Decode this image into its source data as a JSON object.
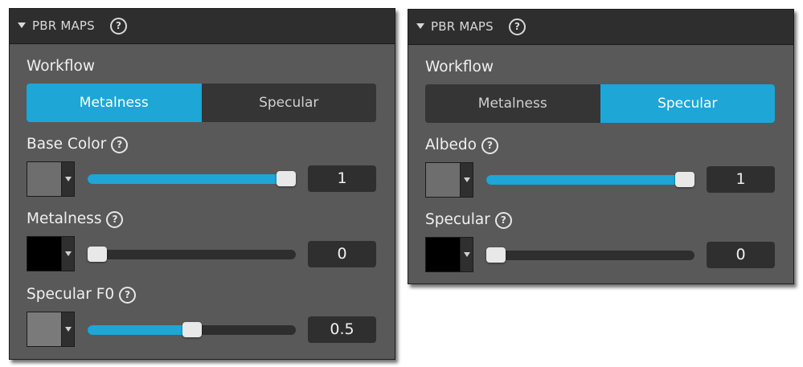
{
  "panels": [
    {
      "header": "PBR MAPS",
      "workflow_label": "Workflow",
      "workflow_options": [
        "Metalness",
        "Specular"
      ],
      "workflow_selected": "Metalness",
      "properties": [
        {
          "label": "Base Color",
          "swatch_color": "#6e6e6e",
          "value": "1",
          "level": 1.0
        },
        {
          "label": "Metalness",
          "swatch_color": "#000000",
          "value": "0",
          "level": 0.0
        },
        {
          "label": "Specular F0",
          "swatch_color": "#7a7a7a",
          "value": "0.5",
          "level": 0.5
        }
      ]
    },
    {
      "header": "PBR MAPS",
      "workflow_label": "Workflow",
      "workflow_options": [
        "Metalness",
        "Specular"
      ],
      "workflow_selected": "Specular",
      "properties": [
        {
          "label": "Albedo",
          "swatch_color": "#6e6e6e",
          "value": "1",
          "level": 1.0
        },
        {
          "label": "Specular",
          "swatch_color": "#000000",
          "value": "0",
          "level": 0.0
        }
      ]
    }
  ],
  "icons": {
    "collapse": "caret-down-icon",
    "help": "question-circle-icon",
    "dropdown": "caret-down-icon"
  },
  "colors": {
    "accent": "#1da6d6",
    "panel_bg": "#595959",
    "header_bg": "#2e2e2e",
    "control_bg": "#2f2f2f"
  }
}
